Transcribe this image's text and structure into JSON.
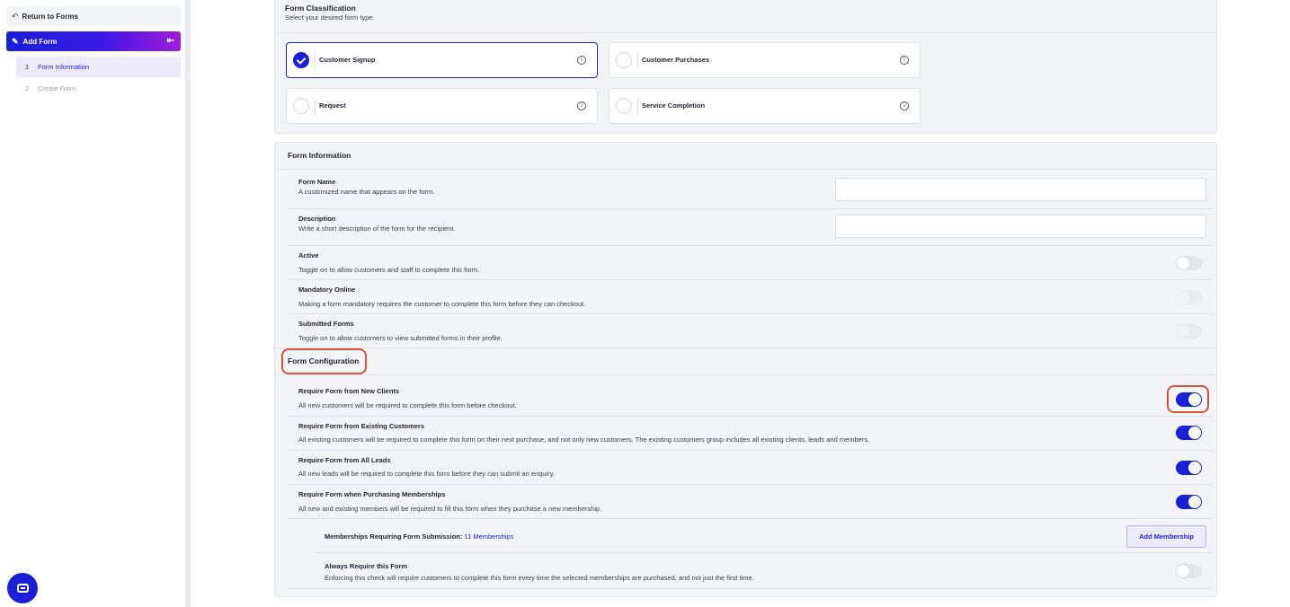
{
  "sidebar": {
    "return_label": "Return to Forms",
    "add_form_label": "Add Form",
    "steps": [
      {
        "num": "1",
        "label": "Form Information"
      },
      {
        "num": "2",
        "label": "Create Form"
      }
    ]
  },
  "classification": {
    "title": "Form Classification",
    "subtitle": "Select your desired form type.",
    "options": [
      {
        "label": "Customer Signup",
        "selected": true
      },
      {
        "label": "Customer Purchases",
        "selected": false
      },
      {
        "label": "Request",
        "selected": false
      },
      {
        "label": "Service Completion",
        "selected": false
      }
    ]
  },
  "form_info": {
    "title": "Form Information",
    "form_name": {
      "title": "Form Name",
      "desc": "A customized name that appears on the form.",
      "value": ""
    },
    "description": {
      "title": "Description",
      "desc": "Write a short description of the form for the recipient.",
      "value": ""
    },
    "active": {
      "title": "Active",
      "desc": "Toggle on to allow customers and staff to complete this form.",
      "on": false
    },
    "mandatory": {
      "title": "Mandatory Online",
      "desc": "Making a form mandatory requires the customer to complete this form before they can checkout.",
      "on": false,
      "disabled": true
    },
    "submitted": {
      "title": "Submitted Forms",
      "desc": "Toggle on to allow customers to view submitted forms in their profile.",
      "on": false,
      "disabled": true
    }
  },
  "config": {
    "title": "Form Configuration",
    "new_clients": {
      "title": "Require Form from New Clients",
      "desc": "All new customers will be required to complete this form before checkout.",
      "on": true
    },
    "existing": {
      "title": "Require Form from Existing Customers",
      "desc": "All existing customers will be required to complete this form on their next purchase, and not only new customers. The existing customers group includes all existing clients, leads and members.",
      "on": true
    },
    "leads": {
      "title": "Require Form from All Leads",
      "desc": "All new leads will be required to complete this form before they can submit an enquiry.",
      "on": true
    },
    "memberships": {
      "title": "Require Form when Purchasing Memberships",
      "desc": "All new and existing members will be required to fill this form when they purchase a new membership.",
      "on": true
    },
    "memberships_requiring": {
      "label": "Memberships Requiring Form Submission:",
      "count_link": "11 Memberships",
      "button": "Add Membership"
    },
    "always": {
      "title": "Always Require this Form",
      "desc": "Enforcing this check will require customers to complete this form every time the selected memberships are purchased, and not just the first time.",
      "on": false
    }
  },
  "colors": {
    "accent": "#1b1fd6",
    "highlight": "#d9533f"
  },
  "icons": [
    "arrow-left-icon",
    "edit-icon",
    "collapse-icon",
    "check-icon",
    "info-icon",
    "chat-icon"
  ]
}
